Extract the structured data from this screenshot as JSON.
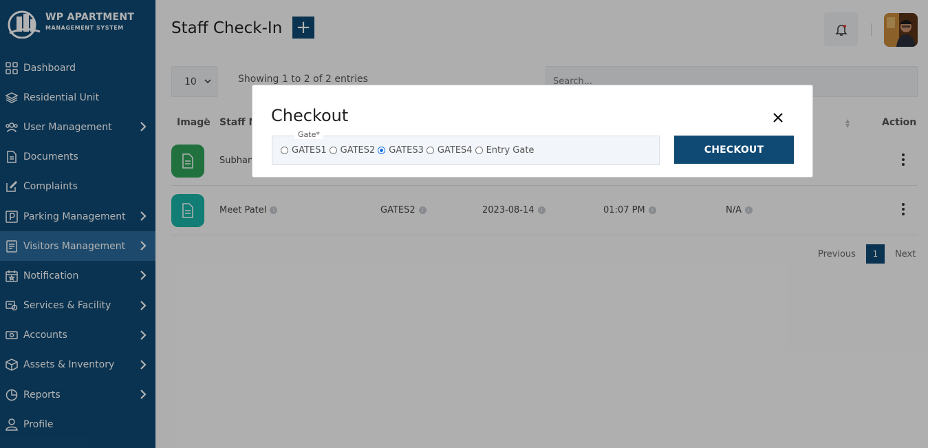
{
  "brand": {
    "title": "WP APARTMENT",
    "subtitle": "MANAGEMENT SYSTEM"
  },
  "sidebar": {
    "items": [
      {
        "label": "Dashboard",
        "icon": "grid-icon",
        "has_chevron": false
      },
      {
        "label": "Residential Unit",
        "icon": "layers-icon",
        "has_chevron": false
      },
      {
        "label": "User Management",
        "icon": "users-icon",
        "has_chevron": true
      },
      {
        "label": "Documents",
        "icon": "document-icon",
        "has_chevron": false
      },
      {
        "label": "Complaints",
        "icon": "edit-icon",
        "has_chevron": false
      },
      {
        "label": "Parking Management",
        "icon": "parking-icon",
        "has_chevron": true
      },
      {
        "label": "Visitors Management",
        "icon": "clipboard-icon",
        "has_chevron": true,
        "active": true
      },
      {
        "label": "Notification",
        "icon": "calendar-star-icon",
        "has_chevron": true
      },
      {
        "label": "Services & Facility",
        "icon": "service-icon",
        "has_chevron": true
      },
      {
        "label": "Accounts",
        "icon": "money-icon",
        "has_chevron": true
      },
      {
        "label": "Assets & Inventory",
        "icon": "box-icon",
        "has_chevron": true
      },
      {
        "label": "Reports",
        "icon": "pie-chart-icon",
        "has_chevron": true
      },
      {
        "label": "Profile",
        "icon": "user-icon",
        "has_chevron": false
      }
    ]
  },
  "header": {
    "title": "Staff Check-In",
    "add_label": "+"
  },
  "table_controls": {
    "page_length": "10",
    "info": "Showing 1 to 2 of 2 entries",
    "search_placeholder": "Search..."
  },
  "table": {
    "headers": {
      "image": "Image",
      "staff": "Staff M",
      "action": "Action"
    },
    "rows": [
      {
        "name": "Subhan",
        "gate": "",
        "date": "",
        "time": "",
        "extra": "",
        "image_color": "#2ea25a"
      },
      {
        "name": "Meet Patel",
        "gate": "GATES2",
        "date": "2023-08-14",
        "time": "01:07 PM",
        "extra": "N/A",
        "image_color": "#1ab3a6"
      }
    ]
  },
  "pagination": {
    "previous": "Previous",
    "current": "1",
    "next": "Next"
  },
  "modal": {
    "title": "Checkout",
    "gate_legend": "Gate*",
    "gates": [
      {
        "label": "GATES1",
        "checked": false
      },
      {
        "label": "GATES2",
        "checked": false
      },
      {
        "label": "GATES3",
        "checked": true
      },
      {
        "label": "GATES4",
        "checked": false
      },
      {
        "label": "Entry Gate",
        "checked": false
      }
    ],
    "checkout_label": "CHECKOUT"
  },
  "colors": {
    "sidebar_bg": "#0f4a74",
    "active_item": "#2a6a9b",
    "primary": "#0f4a74"
  }
}
